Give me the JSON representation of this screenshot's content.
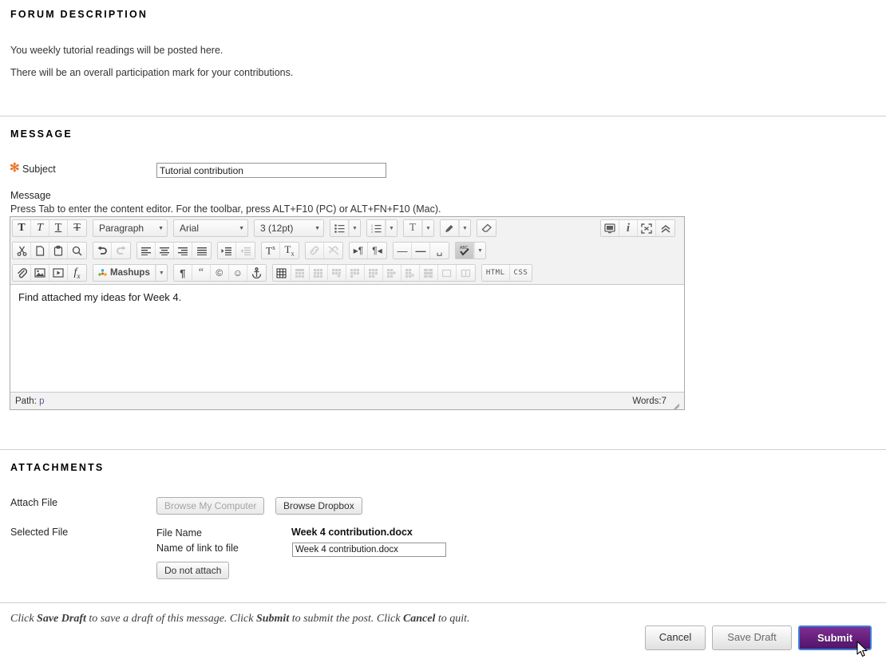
{
  "forum_description": {
    "title": "FORUM DESCRIPTION",
    "lines": [
      "You weekly tutorial readings will be posted here.",
      "There will be an overall participation mark for your contributions."
    ]
  },
  "message": {
    "title": "MESSAGE",
    "subject_label": "Subject",
    "subject_value": "Tutorial contribution",
    "required_marker": "✻",
    "message_label": "Message",
    "editor_hint": "Press Tab to enter the content editor. For the toolbar, press ALT+F10 (PC) or ALT+FN+F10 (Mac).",
    "editor": {
      "body_text": "Find attached my ideas for Week 4.",
      "format_select": "Paragraph",
      "font_select": "Arial",
      "size_select": "3 (12pt)",
      "mashups_label": "Mashups",
      "html_label": "HTML",
      "css_label": "CSS",
      "status_path_label": "Path:",
      "status_path_value": "p",
      "status_words": "Words:7"
    }
  },
  "attachments": {
    "title": "ATTACHMENTS",
    "attach_file_label": "Attach File",
    "browse_my_computer_label": "Browse My Computer",
    "browse_dropbox_label": "Browse Dropbox",
    "selected_file_label": "Selected File",
    "file_name_label": "File Name",
    "file_name_value": "Week 4 contribution.docx",
    "link_name_label": "Name of link to file",
    "link_name_value": "Week 4 contribution.docx",
    "do_not_attach_label": "Do not attach"
  },
  "footer": {
    "instructions_parts": [
      "Click ",
      "Save Draft",
      " to save a draft of this message. Click ",
      "Submit",
      " to submit the post. Click ",
      "Cancel",
      " to quit."
    ],
    "cancel_label": "Cancel",
    "save_draft_label": "Save Draft",
    "submit_label": "Submit"
  },
  "colors": {
    "required_asterisk": "#e8782b",
    "submit_background": "#6b2180",
    "submit_border": "#3f7fd6",
    "divider": "#cfcfcf",
    "toolbar_background": "#f2f2f2"
  }
}
